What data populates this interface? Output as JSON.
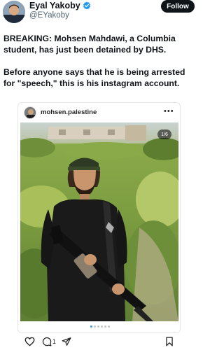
{
  "author": {
    "name": "Eyal Yakoby",
    "handle": "@EYakoby",
    "follow_label": "Follow"
  },
  "tweet": {
    "paragraph1": "BREAKING: Mohsen Mahdawi, a Columbia student, has just been detained by DHS.",
    "paragraph2": "Before anyone says that he is being arrested for \"speech,\" this is his instagram account."
  },
  "instagram": {
    "username": "mohsen.palestine",
    "more_label": "•••",
    "image_counter": "1/6",
    "carousel_total": 6,
    "carousel_active_index": 0
  },
  "actions": {
    "comment_count": "1",
    "icons": [
      "heart-icon",
      "comment-icon",
      "share-icon",
      "bookmark-icon"
    ]
  },
  "colors": {
    "verified": "#1d9bf0",
    "follow_bg": "#0f1419",
    "carousel_active": "#3b9ae1"
  }
}
